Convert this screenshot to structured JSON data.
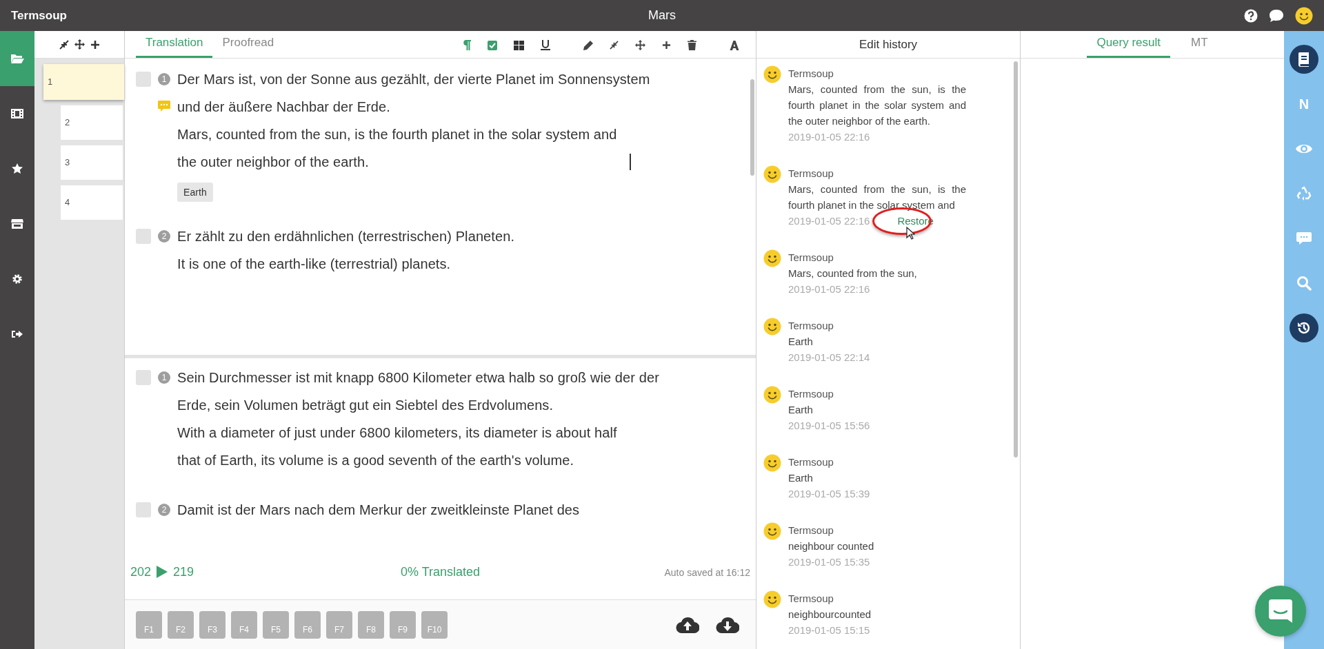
{
  "app_title": "Termsoup",
  "document_title": "Mars",
  "sidebar": {
    "items": [
      {
        "kind": "folder",
        "selected": true
      },
      {
        "kind": "film",
        "selected": false
      },
      {
        "kind": "star",
        "selected": false
      },
      {
        "kind": "store",
        "selected": false
      },
      {
        "kind": "gear",
        "selected": false
      },
      {
        "kind": "logout",
        "selected": false
      }
    ]
  },
  "segment_list": {
    "items": [
      {
        "label": "1",
        "selected": true
      },
      {
        "label": "2",
        "selected": false
      },
      {
        "label": "3",
        "selected": false
      },
      {
        "label": "4",
        "selected": false
      }
    ]
  },
  "editor": {
    "tabs": [
      {
        "label": "Translation",
        "selected": true
      },
      {
        "label": "Proofread",
        "selected": false
      }
    ],
    "toggles": [
      {
        "kind": "pilcrow",
        "on": true
      },
      {
        "kind": "checkbox",
        "on": true
      },
      {
        "kind": "grid",
        "on": false
      },
      {
        "kind": "underline",
        "on": false
      }
    ],
    "upper_segments": [
      {
        "number": "1",
        "checked": false,
        "has_comment": true,
        "source": "Der Mars ist, von der Sonne aus gezählt, der vierte Planet im Sonnensystem und der äußere Nachbar der Erde.",
        "target": "Mars, counted from the sun, is the fourth planet in the solar system and the outer neighbor of the earth.",
        "editing": true,
        "terms": [
          "Earth"
        ]
      },
      {
        "number": "2",
        "checked": false,
        "has_comment": false,
        "source": "Er zählt zu den erdähnlichen (terrestrischen) Planeten.",
        "target": "It is one of the earth-like (terrestrial) planets.",
        "editing": false
      }
    ],
    "lower_segments": [
      {
        "number": "1",
        "checked": false,
        "has_comment": false,
        "source": "Sein Durchmesser ist mit knapp 6800 Kilometer etwa halb so groß wie der der Erde, sein Volumen beträgt gut ein Siebtel des Erdvolumens.",
        "target": "With a diameter of just under 6800 kilometers, its diameter is about half that of Earth, its volume is a good seventh of the earth's volume.",
        "editing": false
      },
      {
        "number": "2",
        "checked": false,
        "has_comment": false,
        "source": "Damit ist der Mars nach dem Merkur der zweitkleinste Planet des",
        "editing": false
      }
    ],
    "progress": {
      "from": "202",
      "to": "219",
      "status": "0% Translated",
      "autosave": "Auto saved at 16:12"
    },
    "function_keys": [
      "F1",
      "F2",
      "F3",
      "F4",
      "F5",
      "F6",
      "F7",
      "F8",
      "F9",
      "F10"
    ]
  },
  "edit_history": {
    "title": "Edit history",
    "entries": [
      {
        "author": "Termsoup",
        "text": "Mars, counted from the sun, is the fourth planet in the solar system and the outer neighbor of the earth.",
        "time": "2019-01-05  22:16"
      },
      {
        "author": "Termsoup",
        "text": "Mars, counted from the sun, is the fourth planet in the solar system and",
        "time": "2019-01-05  22:16",
        "restore": "Restore",
        "highlighted": true
      },
      {
        "author": "Termsoup",
        "text": "Mars, counted from the sun,",
        "time": "2019-01-05  22:16"
      },
      {
        "author": "Termsoup",
        "text": "Earth",
        "time": "2019-01-05  22:14"
      },
      {
        "author": "Termsoup",
        "text": "Earth",
        "time": "2019-01-05  15:56"
      },
      {
        "author": "Termsoup",
        "text": "Earth",
        "time": "2019-01-05  15:39"
      },
      {
        "author": "Termsoup",
        "text": "neighbour  counted",
        "time": "2019-01-05  15:35"
      },
      {
        "author": "Termsoup",
        "text": "neighbourcounted",
        "time": "2019-01-05  15:15"
      }
    ]
  },
  "query_panel": {
    "tabs": [
      {
        "label": "Query result",
        "selected": true
      },
      {
        "label": "MT",
        "selected": false
      }
    ]
  },
  "tool_bar": {
    "items": [
      {
        "kind": "book",
        "selected": true
      },
      {
        "kind": "letter",
        "label": "N",
        "selected": false
      },
      {
        "kind": "eye",
        "selected": false
      },
      {
        "kind": "recycle",
        "selected": false
      },
      {
        "kind": "comment",
        "selected": false
      },
      {
        "kind": "search",
        "selected": false
      },
      {
        "kind": "history",
        "selected": true
      }
    ]
  }
}
